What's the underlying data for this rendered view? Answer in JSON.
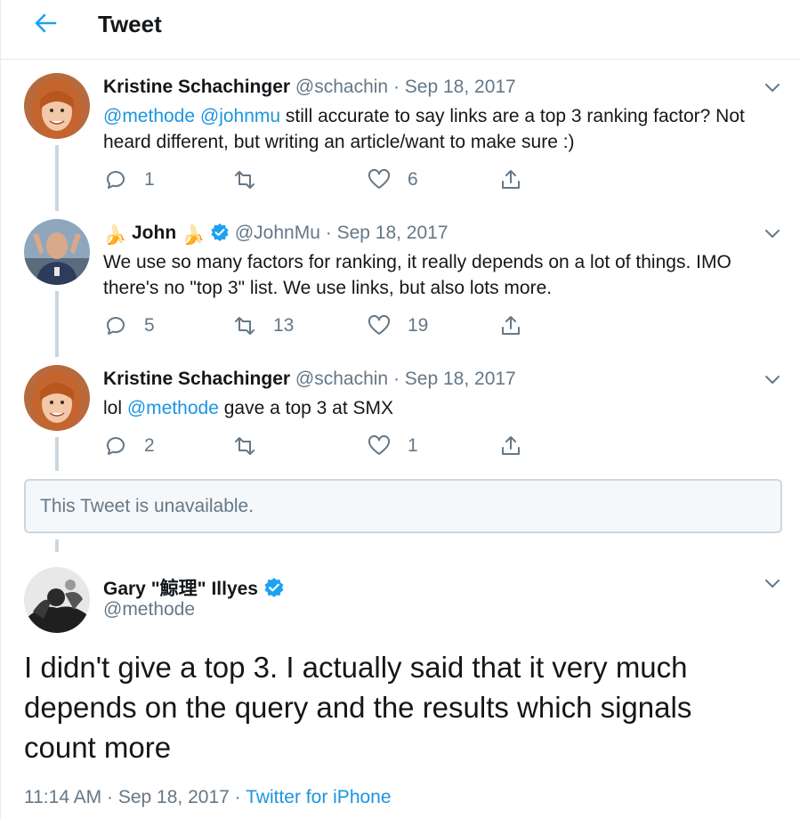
{
  "header": {
    "title": "Tweet",
    "back_icon": "arrow-left-icon"
  },
  "colors": {
    "accent": "#1b95e0",
    "muted": "#657786",
    "text": "#14171a",
    "line": "#ccd6dd"
  },
  "tweets": [
    {
      "name": "Kristine Schachinger",
      "handle": "@schachin",
      "separator": "·",
      "date": "Sep 18, 2017",
      "body": [
        {
          "type": "mention",
          "text": "@methode"
        },
        {
          "type": "text",
          "text": " "
        },
        {
          "type": "mention",
          "text": "@johnmu"
        },
        {
          "type": "text",
          "text": " still accurate to say links are a top 3 ranking factor? Not heard different, but writing an article/want to make sure :)"
        }
      ],
      "replies": "1",
      "retweets": "",
      "likes": "6"
    },
    {
      "name_prefix_emoji": "🍌",
      "name": "John",
      "name_suffix_emoji": "🍌",
      "verified": true,
      "handle": "@JohnMu",
      "separator": "·",
      "date": "Sep 18, 2017",
      "body": [
        {
          "type": "text",
          "text": "We use so many factors for ranking, it really depends on a lot of things. IMO there's no \"top 3\" list. We use links, but also lots more."
        }
      ],
      "replies": "5",
      "retweets": "13",
      "likes": "19"
    },
    {
      "name": "Kristine Schachinger",
      "handle": "@schachin",
      "separator": "·",
      "date": "Sep 18, 2017",
      "body": [
        {
          "type": "text",
          "text": "lol "
        },
        {
          "type": "mention",
          "text": "@methode"
        },
        {
          "type": "text",
          "text": " gave a top 3 at SMX"
        }
      ],
      "replies": "2",
      "retweets": "",
      "likes": "1"
    }
  ],
  "unavailable": {
    "text": "This Tweet is unavailable."
  },
  "main_tweet": {
    "name": "Gary \"鯨理\" Illyes",
    "verified": true,
    "handle": "@methode",
    "text": "I didn't give a top 3. I actually said that it very much depends on the query and the results which signals count more",
    "time": "11:14 AM",
    "separator1": "·",
    "date": "Sep 18, 2017",
    "separator2": "·",
    "source": "Twitter for iPhone"
  }
}
